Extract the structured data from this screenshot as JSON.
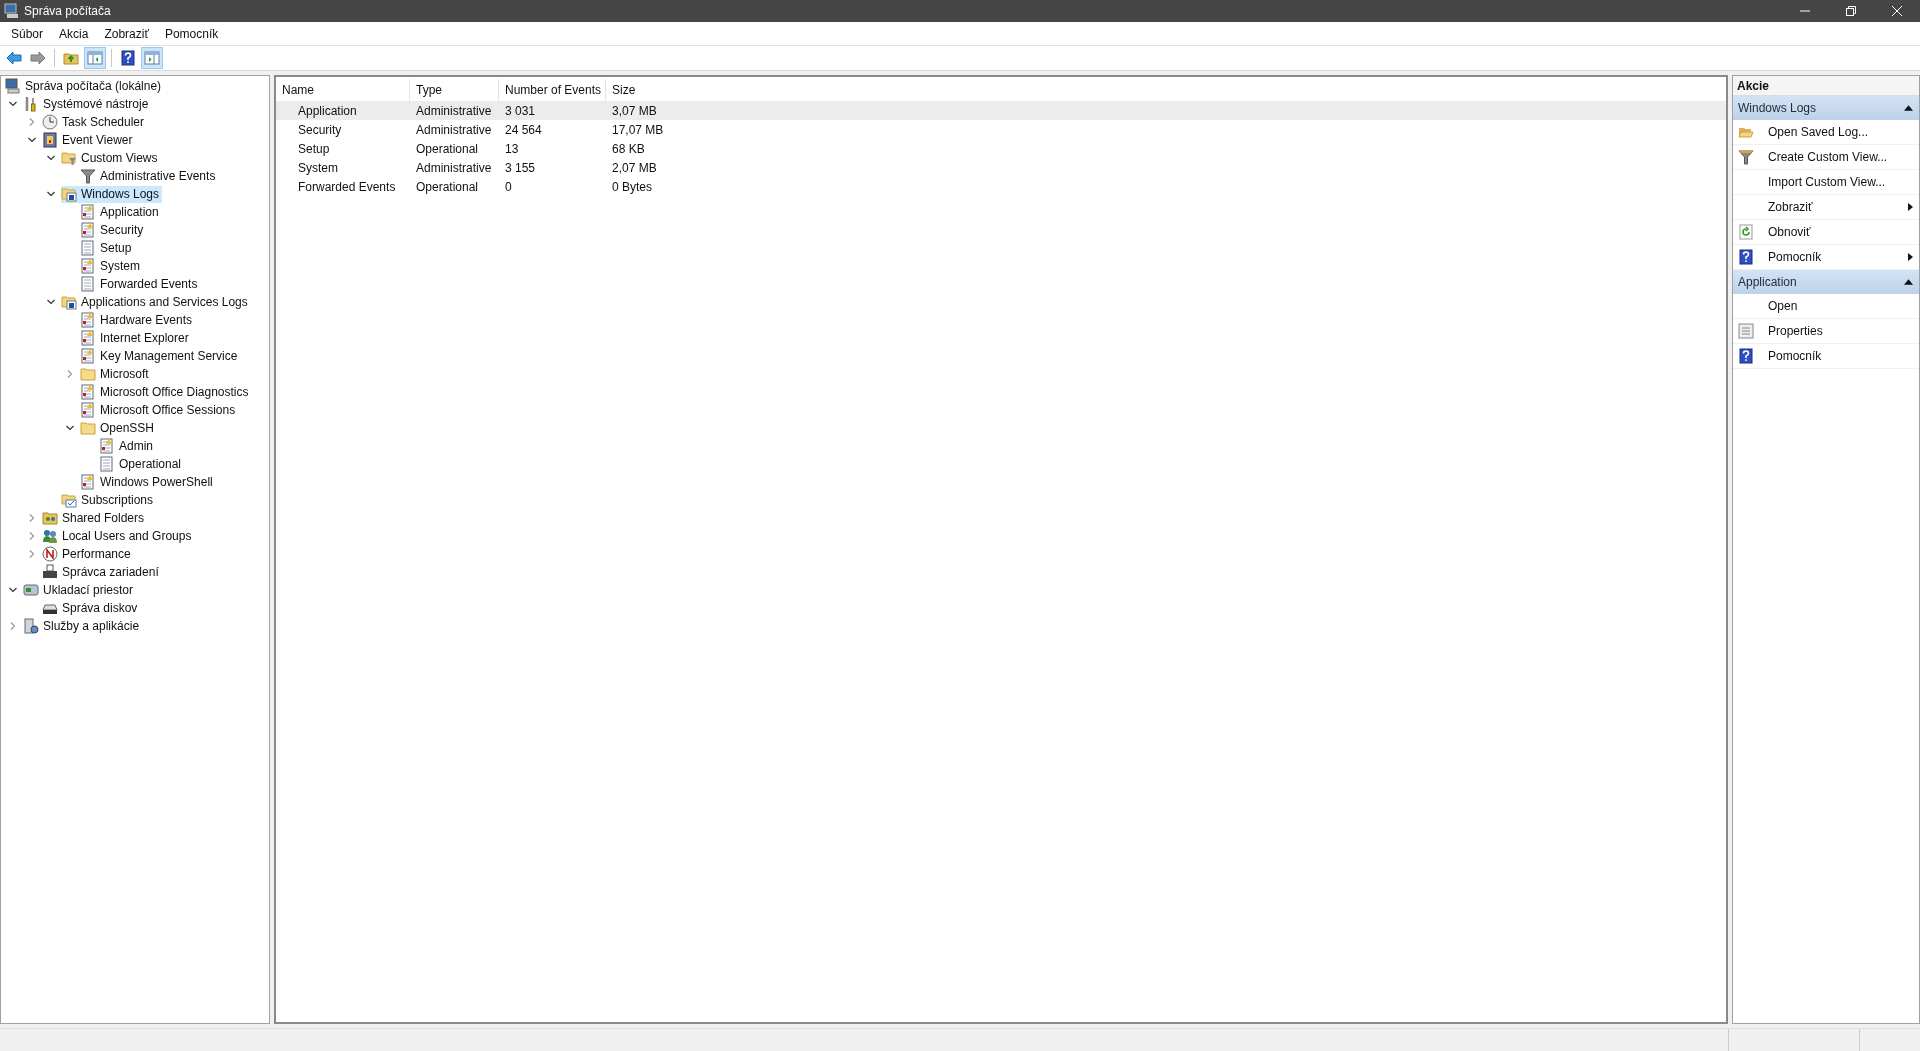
{
  "window": {
    "title": "Správa počítača"
  },
  "menu": [
    "Súbor",
    "Akcia",
    "Zobraziť",
    "Pomocník"
  ],
  "toolbar": [
    {
      "kind": "back",
      "pressed": false
    },
    {
      "kind": "forward",
      "pressed": false
    },
    {
      "kind": "sep"
    },
    {
      "kind": "up",
      "pressed": false
    },
    {
      "kind": "tree-pane",
      "pressed": true
    },
    {
      "kind": "sep"
    },
    {
      "kind": "help",
      "pressed": false
    },
    {
      "kind": "action-pane",
      "pressed": true
    }
  ],
  "tree": [
    {
      "label": "Správa počítača (lokálne)",
      "kind": "computer",
      "selected": false,
      "children": [
        {
          "label": "Systémové nástroje",
          "kind": "tools",
          "selected": false,
          "expanded": true,
          "children": [
            {
              "label": "Task Scheduler",
              "kind": "clock",
              "selected": false,
              "expanded": false
            },
            {
              "label": "Event Viewer",
              "kind": "viewer",
              "selected": false,
              "expanded": true,
              "children": [
                {
                  "label": "Custom Views",
                  "kind": "filter-folder",
                  "selected": false,
                  "expanded": true,
                  "children": [
                    {
                      "label": "Administrative Events",
                      "kind": "filter",
                      "selected": false
                    }
                  ]
                },
                {
                  "label": "Windows Logs",
                  "kind": "logs-folder",
                  "selected": true,
                  "expanded": true,
                  "children": [
                    {
                      "label": "Application",
                      "kind": "log-alert",
                      "selected": false
                    },
                    {
                      "label": "Security",
                      "kind": "log-alert",
                      "selected": false
                    },
                    {
                      "label": "Setup",
                      "kind": "log",
                      "selected": false
                    },
                    {
                      "label": "System",
                      "kind": "log-alert",
                      "selected": false
                    },
                    {
                      "label": "Forwarded Events",
                      "kind": "log",
                      "selected": false
                    }
                  ]
                },
                {
                  "label": "Applications and Services Logs",
                  "kind": "logs-folder",
                  "selected": false,
                  "expanded": true,
                  "children": [
                    {
                      "label": "Hardware Events",
                      "kind": "log-alert",
                      "selected": false
                    },
                    {
                      "label": "Internet Explorer",
                      "kind": "log-alert",
                      "selected": false
                    },
                    {
                      "label": "Key Management Service",
                      "kind": "log-alert",
                      "selected": false
                    },
                    {
                      "label": "Microsoft",
                      "kind": "folder",
                      "selected": false,
                      "expanded": false
                    },
                    {
                      "label": "Microsoft Office Diagnostics",
                      "kind": "log-alert",
                      "selected": false
                    },
                    {
                      "label": "Microsoft Office Sessions",
                      "kind": "log-alert",
                      "selected": false
                    },
                    {
                      "label": "OpenSSH",
                      "kind": "folder",
                      "selected": false,
                      "expanded": true,
                      "children": [
                        {
                          "label": "Admin",
                          "kind": "log-alert",
                          "selected": false
                        },
                        {
                          "label": "Operational",
                          "kind": "log",
                          "selected": false
                        }
                      ]
                    },
                    {
                      "label": "Windows PowerShell",
                      "kind": "log-alert",
                      "selected": false
                    }
                  ]
                },
                {
                  "label": "Subscriptions",
                  "kind": "subscriptions",
                  "selected": false
                }
              ]
            },
            {
              "label": "Shared Folders",
              "kind": "shared",
              "selected": false,
              "expanded": false
            },
            {
              "label": "Local Users and Groups",
              "kind": "users",
              "selected": false,
              "expanded": false
            },
            {
              "label": "Performance",
              "kind": "performance",
              "selected": false,
              "expanded": false
            },
            {
              "label": "Správca zariadení",
              "kind": "device",
              "selected": false
            }
          ]
        },
        {
          "label": "Ukladací priestor",
          "kind": "storage",
          "selected": false,
          "expanded": true,
          "children": [
            {
              "label": "Správa diskov",
              "kind": "disk",
              "selected": false
            }
          ]
        },
        {
          "label": "Služby a aplikácie",
          "kind": "services",
          "selected": false,
          "expanded": false
        }
      ]
    }
  ],
  "table": {
    "columns": [
      "Name",
      "Type",
      "Number of Events",
      "Size"
    ],
    "rows": [
      {
        "selected": true,
        "cells": [
          "Application",
          "Administrative",
          "3 031",
          "3,07 MB"
        ]
      },
      {
        "selected": false,
        "cells": [
          "Security",
          "Administrative",
          "24 564",
          "17,07 MB"
        ]
      },
      {
        "selected": false,
        "cells": [
          "Setup",
          "Operational",
          "13",
          "68 KB"
        ]
      },
      {
        "selected": false,
        "cells": [
          "System",
          "Administrative",
          "3 155",
          "2,07 MB"
        ]
      },
      {
        "selected": false,
        "cells": [
          "Forwarded Events",
          "Operational",
          "0",
          "0 Bytes"
        ]
      }
    ]
  },
  "actions": {
    "title": "Akcie",
    "sections": [
      {
        "title": "Windows Logs",
        "expanded": true,
        "items": [
          {
            "label": "Open Saved Log...",
            "kind": "open-folder",
            "submenu": false
          },
          {
            "label": "Create Custom View...",
            "kind": "filter",
            "submenu": false
          },
          {
            "label": "Import Custom View...",
            "kind": "none",
            "submenu": false
          },
          {
            "label": "Zobraziť",
            "kind": "none",
            "submenu": true
          },
          {
            "label": "Obnoviť",
            "kind": "refresh",
            "submenu": false
          },
          {
            "label": "Pomocník",
            "kind": "help",
            "submenu": true
          }
        ]
      },
      {
        "title": "Application",
        "expanded": true,
        "items": [
          {
            "label": "Open",
            "kind": "none",
            "submenu": false
          },
          {
            "label": "Properties",
            "kind": "properties",
            "submenu": false
          },
          {
            "label": "Pomocník",
            "kind": "help",
            "submenu": false
          }
        ]
      }
    ]
  }
}
